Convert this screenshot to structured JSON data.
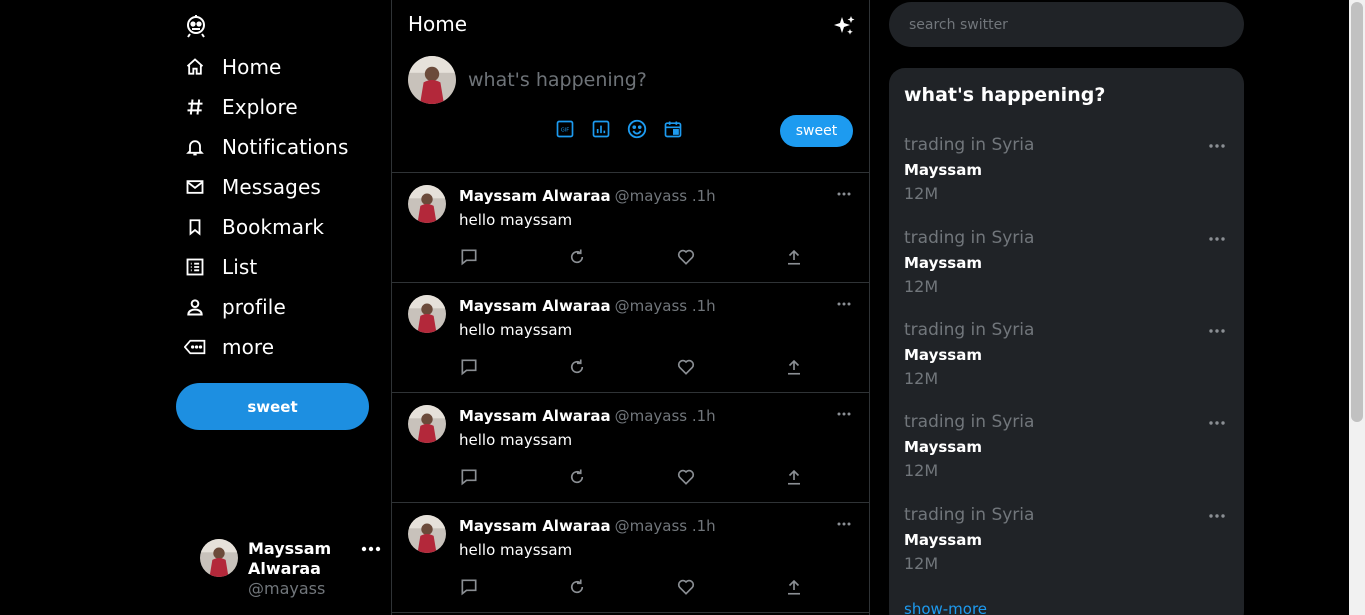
{
  "app": {
    "accent": "#1d9bf0",
    "background": "#000000"
  },
  "sidebar": {
    "logo_icon": "robot-logo-icon",
    "items": [
      {
        "label": "Home",
        "icon": "home-icon"
      },
      {
        "label": "Explore",
        "icon": "hashtag-icon"
      },
      {
        "label": "Notifications",
        "icon": "bell-icon"
      },
      {
        "label": "Messages",
        "icon": "mail-icon"
      },
      {
        "label": "Bookmark",
        "icon": "bookmark-icon"
      },
      {
        "label": "List",
        "icon": "list-icon"
      },
      {
        "label": "profile",
        "icon": "person-icon"
      },
      {
        "label": "more",
        "icon": "more-icon"
      }
    ],
    "sweet_button": "sweet",
    "user": {
      "name": "Mayssam Alwaraa",
      "handle": "@mayass"
    }
  },
  "feed": {
    "title": "Home",
    "composer": {
      "placeholder": "what's happening?",
      "tools": [
        "gif-icon",
        "poll-icon",
        "emoji-icon",
        "schedule-icon"
      ],
      "button": "sweet"
    },
    "posts": [
      {
        "name": "Mayssam Alwaraa",
        "handle": "@mayass .1h",
        "text": "hello mayssam"
      },
      {
        "name": "Mayssam Alwaraa",
        "handle": "@mayass .1h",
        "text": "hello mayssam"
      },
      {
        "name": "Mayssam Alwaraa",
        "handle": "@mayass .1h",
        "text": "hello mayssam"
      },
      {
        "name": "Mayssam Alwaraa",
        "handle": "@mayass .1h",
        "text": "hello mayssam"
      }
    ]
  },
  "right": {
    "search_placeholder": "search switter",
    "trends_title": "what's happening?",
    "trends": [
      {
        "context": "trading in Syria",
        "name": "Mayssam",
        "count": "12M"
      },
      {
        "context": "trading in Syria",
        "name": "Mayssam",
        "count": "12M"
      },
      {
        "context": "trading in Syria",
        "name": "Mayssam",
        "count": "12M"
      },
      {
        "context": "trading in Syria",
        "name": "Mayssam",
        "count": "12M"
      },
      {
        "context": "trading in Syria",
        "name": "Mayssam",
        "count": "12M"
      }
    ],
    "show_more": "show-more"
  }
}
